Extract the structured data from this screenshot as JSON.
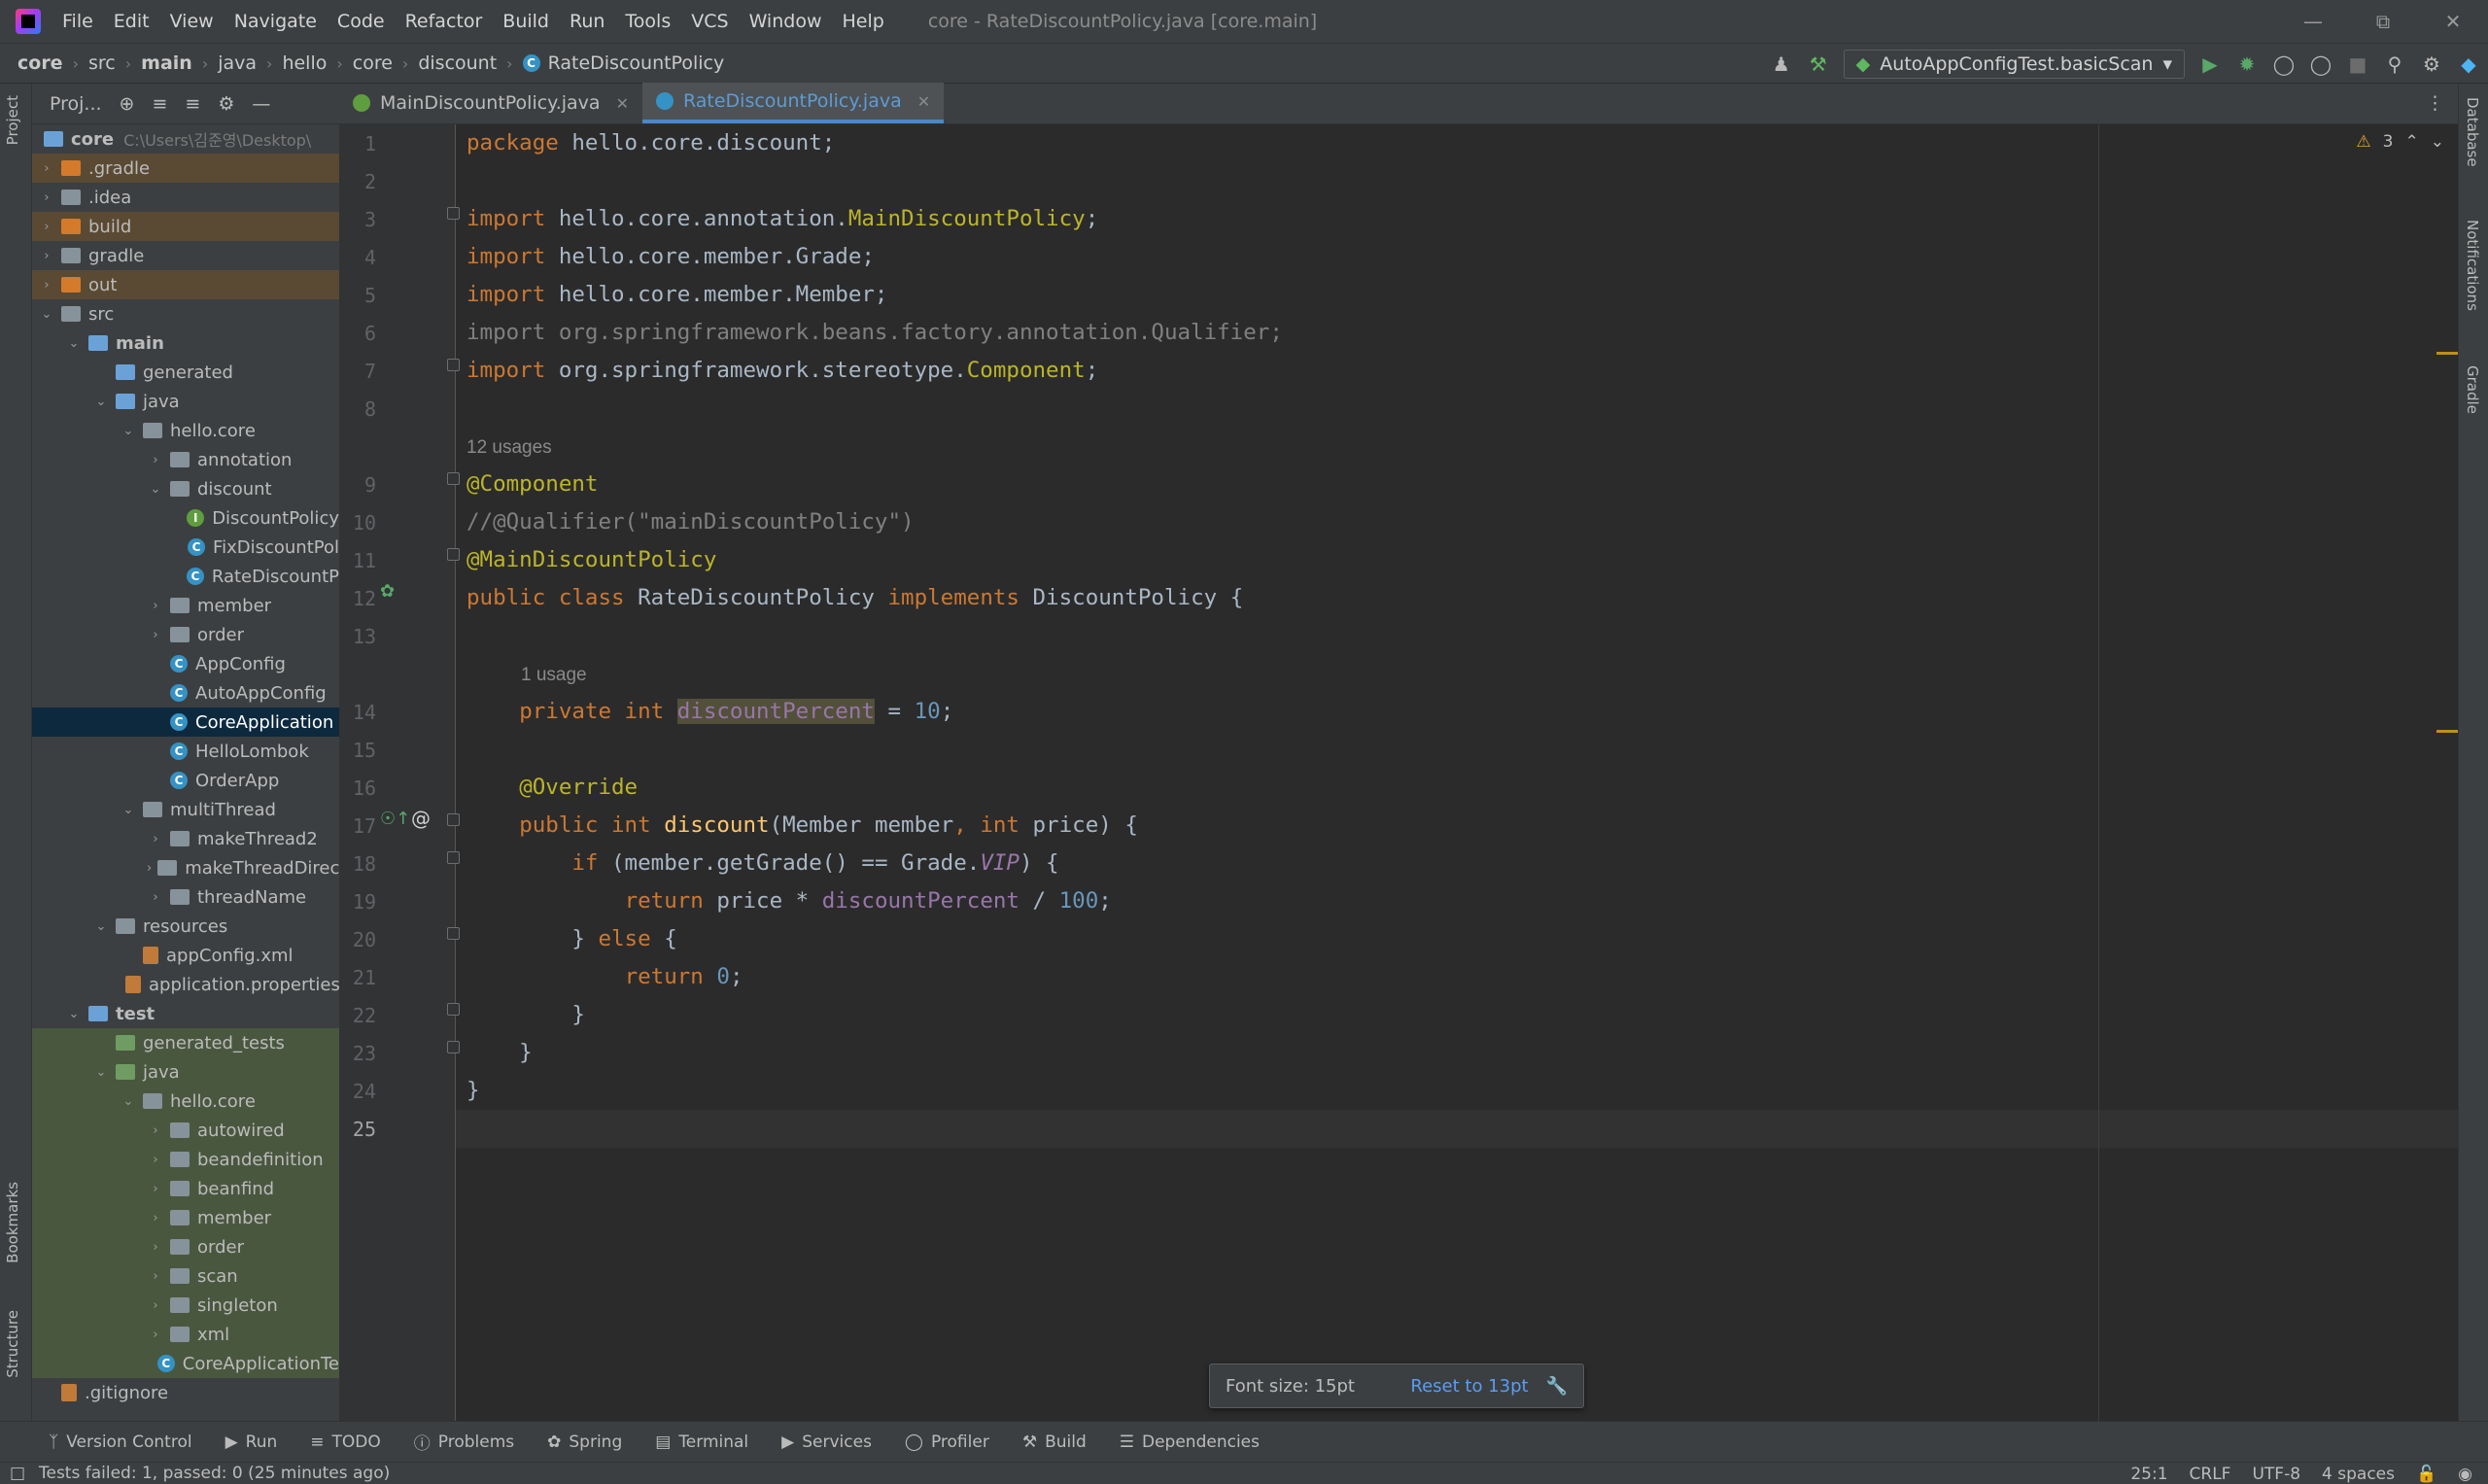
{
  "app": {
    "menu": [
      "File",
      "Edit",
      "View",
      "Navigate",
      "Code",
      "Refactor",
      "Build",
      "Run",
      "Tools",
      "VCS",
      "Window",
      "Help"
    ],
    "window_title": "core - RateDiscountPolicy.java [core.main]"
  },
  "breadcrumb": [
    "core",
    "src",
    "main",
    "java",
    "hello",
    "core",
    "discount",
    "RateDiscountPolicy"
  ],
  "run_config": "AutoAppConfigTest.basicScan",
  "project_panel": {
    "title": "Proj...",
    "root_name": "core",
    "root_path": "C:\\Users\\김준영\\Desktop\\",
    "items": [
      {
        "label": ".gradle",
        "depth": 0,
        "arrow": "›",
        "kind": "folder-orange",
        "bg": "excluded"
      },
      {
        "label": ".idea",
        "depth": 0,
        "arrow": "›",
        "kind": "folder",
        "bg": ""
      },
      {
        "label": "build",
        "depth": 0,
        "arrow": "›",
        "kind": "folder-orange",
        "bg": "excluded"
      },
      {
        "label": "gradle",
        "depth": 0,
        "arrow": "›",
        "kind": "folder",
        "bg": ""
      },
      {
        "label": "out",
        "depth": 0,
        "arrow": "›",
        "kind": "folder-orange",
        "bg": "excluded"
      },
      {
        "label": "src",
        "depth": 0,
        "arrow": "⌄",
        "kind": "folder",
        "bg": ""
      },
      {
        "label": "main",
        "depth": 1,
        "arrow": "⌄",
        "kind": "folder-blue",
        "bg": "",
        "bold": true
      },
      {
        "label": "generated",
        "depth": 2,
        "arrow": "",
        "kind": "folder-blue",
        "bg": ""
      },
      {
        "label": "java",
        "depth": 2,
        "arrow": "⌄",
        "kind": "folder-blue",
        "bg": ""
      },
      {
        "label": "hello.core",
        "depth": 3,
        "arrow": "⌄",
        "kind": "folder",
        "bg": ""
      },
      {
        "label": "annotation",
        "depth": 4,
        "arrow": "›",
        "kind": "folder",
        "bg": ""
      },
      {
        "label": "discount",
        "depth": 4,
        "arrow": "⌄",
        "kind": "folder",
        "bg": ""
      },
      {
        "label": "DiscountPolicy",
        "depth": 5,
        "arrow": "",
        "kind": "intf",
        "bg": ""
      },
      {
        "label": "FixDiscountPol",
        "depth": 5,
        "arrow": "",
        "kind": "cls",
        "bg": ""
      },
      {
        "label": "RateDiscountP",
        "depth": 5,
        "arrow": "",
        "kind": "cls",
        "bg": ""
      },
      {
        "label": "member",
        "depth": 4,
        "arrow": "›",
        "kind": "folder",
        "bg": ""
      },
      {
        "label": "order",
        "depth": 4,
        "arrow": "›",
        "kind": "folder",
        "bg": ""
      },
      {
        "label": "AppConfig",
        "depth": 4,
        "arrow": "",
        "kind": "cls",
        "bg": ""
      },
      {
        "label": "AutoAppConfig",
        "depth": 4,
        "arrow": "",
        "kind": "cls",
        "bg": ""
      },
      {
        "label": "CoreApplication",
        "depth": 4,
        "arrow": "",
        "kind": "cls",
        "bg": "selected"
      },
      {
        "label": "HelloLombok",
        "depth": 4,
        "arrow": "",
        "kind": "cls",
        "bg": ""
      },
      {
        "label": "OrderApp",
        "depth": 4,
        "arrow": "",
        "kind": "cls",
        "bg": ""
      },
      {
        "label": "multiThread",
        "depth": 3,
        "arrow": "⌄",
        "kind": "folder",
        "bg": ""
      },
      {
        "label": "makeThread2",
        "depth": 4,
        "arrow": "›",
        "kind": "folder",
        "bg": ""
      },
      {
        "label": "makeThreadDirect",
        "depth": 4,
        "arrow": "›",
        "kind": "folder",
        "bg": ""
      },
      {
        "label": "threadName",
        "depth": 4,
        "arrow": "›",
        "kind": "folder",
        "bg": ""
      },
      {
        "label": "resources",
        "depth": 2,
        "arrow": "⌄",
        "kind": "folder",
        "bg": ""
      },
      {
        "label": "appConfig.xml",
        "depth": 3,
        "arrow": "",
        "kind": "file-ico",
        "bg": ""
      },
      {
        "label": "application.properties",
        "depth": 3,
        "arrow": "",
        "kind": "file-ico",
        "bg": ""
      },
      {
        "label": "test",
        "depth": 1,
        "arrow": "⌄",
        "kind": "folder-blue",
        "bg": "",
        "bold": true
      },
      {
        "label": "generated_tests",
        "depth": 2,
        "arrow": "",
        "kind": "folder-green",
        "bg": "testbg"
      },
      {
        "label": "java",
        "depth": 2,
        "arrow": "⌄",
        "kind": "folder-green",
        "bg": "testbg"
      },
      {
        "label": "hello.core",
        "depth": 3,
        "arrow": "⌄",
        "kind": "folder",
        "bg": "testbg"
      },
      {
        "label": "autowired",
        "depth": 4,
        "arrow": "›",
        "kind": "folder",
        "bg": "testbg"
      },
      {
        "label": "beandefinition",
        "depth": 4,
        "arrow": "›",
        "kind": "folder",
        "bg": "testbg"
      },
      {
        "label": "beanfind",
        "depth": 4,
        "arrow": "›",
        "kind": "folder",
        "bg": "testbg"
      },
      {
        "label": "member",
        "depth": 4,
        "arrow": "›",
        "kind": "folder",
        "bg": "testbg"
      },
      {
        "label": "order",
        "depth": 4,
        "arrow": "›",
        "kind": "folder",
        "bg": "testbg"
      },
      {
        "label": "scan",
        "depth": 4,
        "arrow": "›",
        "kind": "folder",
        "bg": "testbg"
      },
      {
        "label": "singleton",
        "depth": 4,
        "arrow": "›",
        "kind": "folder",
        "bg": "testbg"
      },
      {
        "label": "xml",
        "depth": 4,
        "arrow": "›",
        "kind": "folder",
        "bg": "testbg"
      },
      {
        "label": "CoreApplicationTe",
        "depth": 4,
        "arrow": "",
        "kind": "cls",
        "bg": "testbg"
      },
      {
        "label": ".gitignore",
        "depth": 0,
        "arrow": "",
        "kind": "file-ico",
        "bg": ""
      }
    ]
  },
  "tabs": [
    {
      "label": "MainDiscountPolicy.java",
      "active": false
    },
    {
      "label": "RateDiscountPolicy.java",
      "active": true
    }
  ],
  "editor": {
    "hints": {
      "usages_12": "12 usages",
      "usages_1": "1 usage"
    },
    "warnings_count": "3",
    "current_line": 25,
    "line_numbers": [
      "1",
      "2",
      "3",
      "4",
      "5",
      "6",
      "7",
      "8",
      "9",
      "10",
      "11",
      "12",
      "13",
      "14",
      "15",
      "16",
      "17",
      "18",
      "19",
      "20",
      "21",
      "22",
      "23",
      "24",
      "25"
    ]
  },
  "font_popup": {
    "label": "Font size: 15pt",
    "reset": "Reset to 13pt"
  },
  "tool_windows": [
    "Version Control",
    "Run",
    "TODO",
    "Problems",
    "Spring",
    "Terminal",
    "Services",
    "Profiler",
    "Build",
    "Dependencies"
  ],
  "left_tabs": {
    "project": "Project",
    "bookmarks": "Bookmarks",
    "structure": "Structure"
  },
  "right_tabs": {
    "database": "Database",
    "notifications": "Notifications",
    "gradle": "Gradle"
  },
  "status": {
    "message": "Tests failed: 1, passed: 0 (25 minutes ago)",
    "position": "25:1",
    "line_sep": "CRLF",
    "encoding": "UTF-8",
    "indent": "4 spaces"
  }
}
